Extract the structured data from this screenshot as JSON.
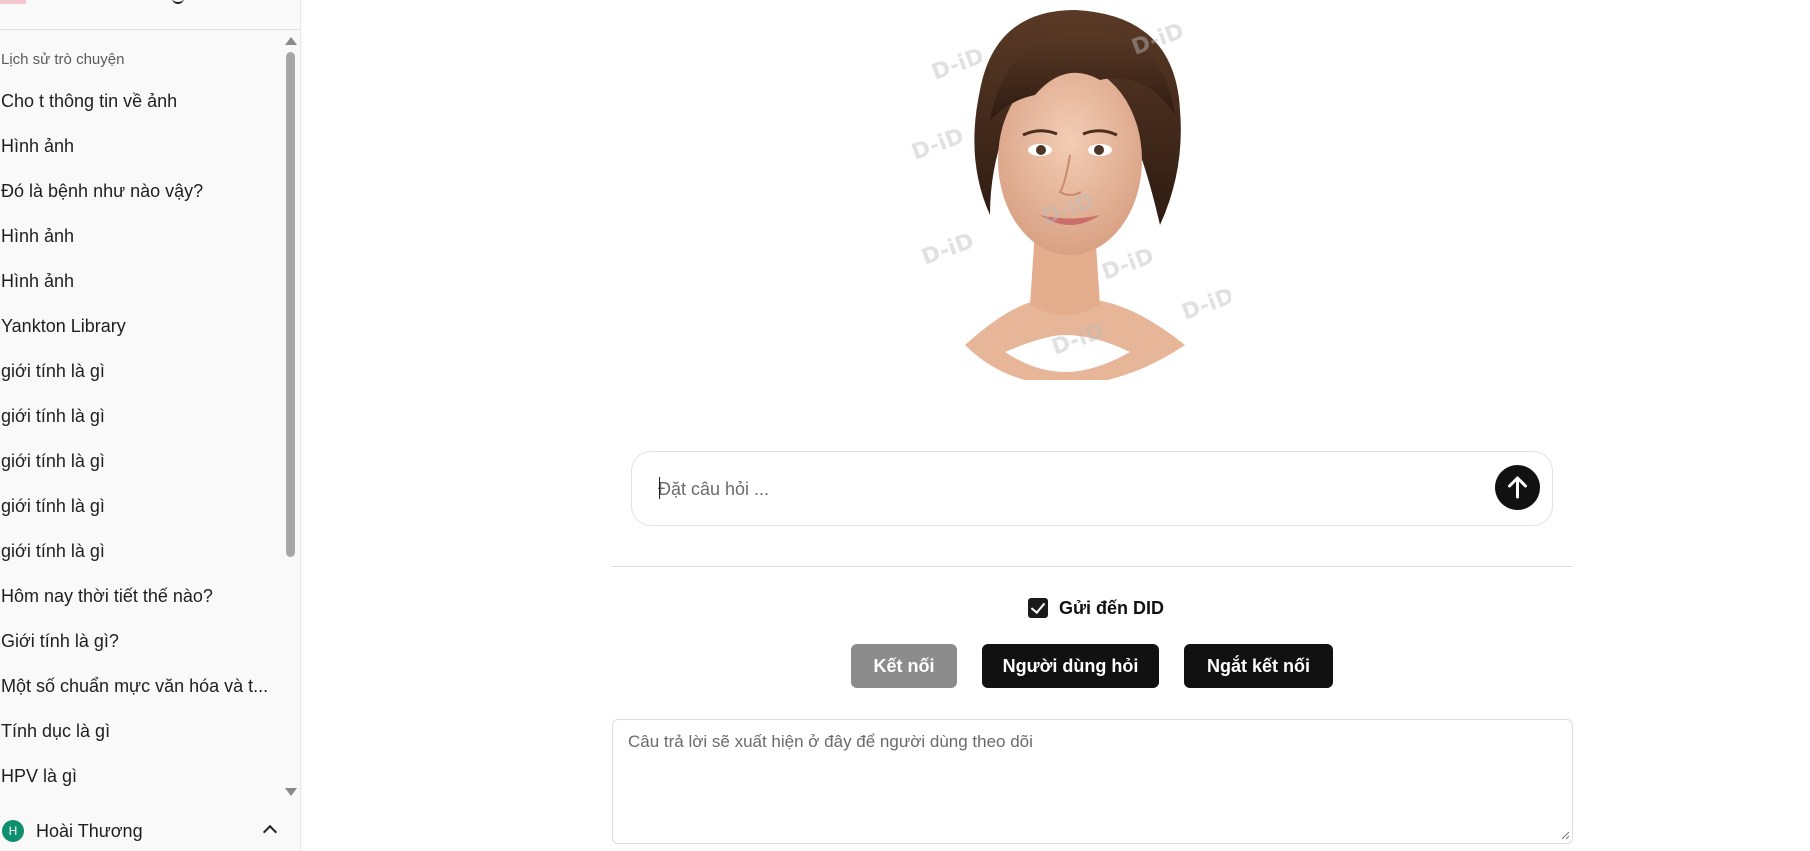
{
  "sidebar": {
    "history_title": "Lịch sử trò chuyện",
    "history": [
      "Cho t thông tin về ảnh",
      "Hình ảnh",
      "Đó là bệnh như nào vậy?",
      "Hình ảnh",
      "Hình ảnh",
      "Yankton Library",
      "giới tính là gì",
      "giới tính là gì",
      "giới tính là gì",
      "giới tính là gì",
      "giới tính là gì",
      "Hôm nay thời tiết thế nào?",
      "Giới tính là gì?",
      "Một số chuẩn mực văn hóa và t...",
      "Tính dục là gì",
      "HPV là gì"
    ],
    "user": {
      "initial": "H",
      "name": "Hoài Thương"
    }
  },
  "main": {
    "avatar_watermark": "D-iD",
    "ask": {
      "placeholder": "Đặt câu hỏi ..."
    },
    "send_to_did": {
      "label": "Gửi đến DID",
      "checked": true
    },
    "buttons": {
      "connect": "Kết nối",
      "user_ask": "Người dùng hỏi",
      "disconnect": "Ngắt kết nối"
    },
    "answer": {
      "placeholder": "Câu trả lời sẽ xuất hiện ở đây để người dùng theo dõi"
    }
  },
  "colors": {
    "primary_button": "#111111",
    "disabled_button": "#8c8c8c",
    "avatar_badge": "#0f8f6e"
  }
}
